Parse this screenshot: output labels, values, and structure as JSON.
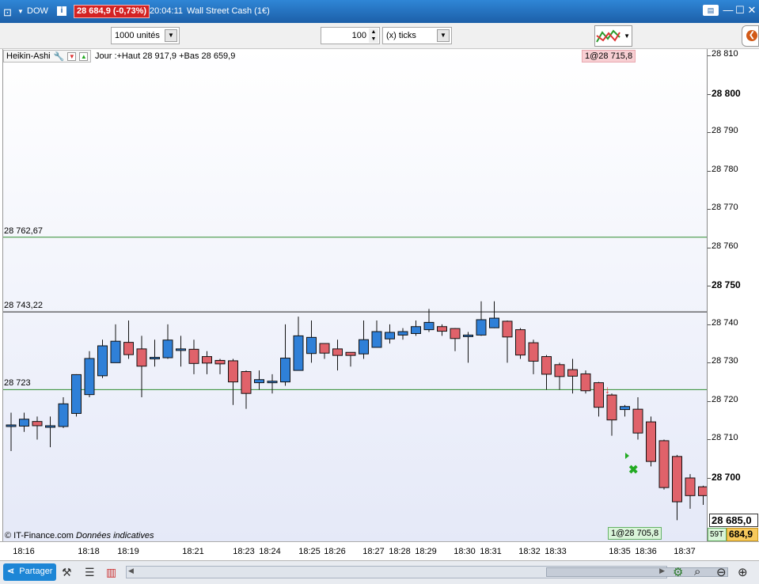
{
  "titlebar": {
    "symbol": "DOW",
    "last_price": "28 684,9 (-0,73%)",
    "time": "20:04:11",
    "instrument": "Wall Street Cash (1€)"
  },
  "toolbar": {
    "units": "1000 unités",
    "ticks_value": "100",
    "ticks_unit": "(x) ticks"
  },
  "chart_header": {
    "indicator": "Heikin-Ashi",
    "info": "Jour :+Haut 28 917,9 +Bas 28 659,9",
    "order_top": "1@28 715,8",
    "order_bottom": "1@28 705,8",
    "watermark": "© IT-Finance.com",
    "watermark_note": "Données indicatives"
  },
  "levels": [
    {
      "label": "28 762,67",
      "value": 28762.67,
      "color": "#2e8b2e"
    },
    {
      "label": "28 743,22",
      "value": 28743.22,
      "color": "#222222"
    },
    {
      "label": "28 723",
      "value": 28723,
      "color": "#2e8b2e"
    }
  ],
  "price_axis": {
    "ticks": [
      {
        "label": "28 810",
        "value": 28810,
        "bold": false
      },
      {
        "label": "28 800",
        "value": 28800,
        "bold": true
      },
      {
        "label": "28 790",
        "value": 28790,
        "bold": false
      },
      {
        "label": "28 780",
        "value": 28780,
        "bold": false
      },
      {
        "label": "28 770",
        "value": 28770,
        "bold": false
      },
      {
        "label": "28 760",
        "value": 28760,
        "bold": false
      },
      {
        "label": "28 750",
        "value": 28750,
        "bold": true
      },
      {
        "label": "28 740",
        "value": 28740,
        "bold": false
      },
      {
        "label": "28 730",
        "value": 28730,
        "bold": false
      },
      {
        "label": "28 720",
        "value": 28720,
        "bold": false
      },
      {
        "label": "28 710",
        "value": 28710,
        "bold": false
      },
      {
        "label": "28 700",
        "value": 28700,
        "bold": true
      }
    ],
    "current_price_label": "28 685,0",
    "countdown": "59T",
    "current_small": "684,9"
  },
  "time_axis": [
    "18:16",
    "18:18",
    "18:19",
    "18:21",
    "18:23",
    "18:24",
    "18:25",
    "18:26",
    "18:27",
    "18:28",
    "18:29",
    "18:30",
    "18:31",
    "18:32",
    "18:33",
    "18:35",
    "18:36",
    "18:37"
  ],
  "bottombar": {
    "share_label": "Partager"
  },
  "colors": {
    "up": "#2f80d8",
    "down": "#e0626a"
  },
  "chart_data": {
    "type": "candlestick",
    "y_range": [
      28685,
      28813
    ],
    "candles": [
      {
        "o": 28713.5,
        "c": 28713.8,
        "h": 28717,
        "l": 28707
      },
      {
        "o": 28713.5,
        "c": 28715.3,
        "h": 28717,
        "l": 28712
      },
      {
        "o": 28714.7,
        "c": 28713.6,
        "h": 28716,
        "l": 28710
      },
      {
        "o": 28713.3,
        "c": 28713.6,
        "h": 28716,
        "l": 28708
      },
      {
        "o": 28713.4,
        "c": 28719.3,
        "h": 28721,
        "l": 28713
      },
      {
        "o": 28716.8,
        "c": 28726.9,
        "h": 28727,
        "l": 28716
      },
      {
        "o": 28721.7,
        "c": 28731.1,
        "h": 28733,
        "l": 28721
      },
      {
        "o": 28726.6,
        "c": 28734.4,
        "h": 28736,
        "l": 28726
      },
      {
        "o": 28730,
        "c": 28735.6,
        "h": 28740,
        "l": 28730
      },
      {
        "o": 28735.3,
        "c": 28732.1,
        "h": 28741,
        "l": 28731
      },
      {
        "o": 28733.6,
        "c": 28729.1,
        "h": 28737,
        "l": 28721
      },
      {
        "o": 28731.1,
        "c": 28731.4,
        "h": 28736,
        "l": 28729
      },
      {
        "o": 28731.3,
        "c": 28735.9,
        "h": 28740,
        "l": 28731
      },
      {
        "o": 28733.6,
        "c": 28733.6,
        "h": 28737,
        "l": 28729
      },
      {
        "o": 28733.5,
        "c": 28729.8,
        "h": 28736,
        "l": 28727
      },
      {
        "o": 28731.6,
        "c": 28729.9,
        "h": 28733,
        "l": 28727
      },
      {
        "o": 28730.6,
        "c": 28729.7,
        "h": 28731,
        "l": 28727
      },
      {
        "o": 28730.5,
        "c": 28725,
        "h": 28731,
        "l": 28719
      },
      {
        "o": 28727.7,
        "c": 28722,
        "h": 28728,
        "l": 28718
      },
      {
        "o": 28724.8,
        "c": 28725.6,
        "h": 28728,
        "l": 28723
      },
      {
        "o": 28725.2,
        "c": 28725.2,
        "h": 28727,
        "l": 28722
      },
      {
        "o": 28725,
        "c": 28731.2,
        "h": 28740,
        "l": 28724
      },
      {
        "o": 28728,
        "c": 28737,
        "h": 28742,
        "l": 28728
      },
      {
        "o": 28732.4,
        "c": 28736.6,
        "h": 28741,
        "l": 28730
      },
      {
        "o": 28735,
        "c": 28732.5,
        "h": 28735,
        "l": 28731
      },
      {
        "o": 28733.6,
        "c": 28731.9,
        "h": 28736,
        "l": 28728
      },
      {
        "o": 28732.7,
        "c": 28731.9,
        "h": 28732,
        "l": 28729
      },
      {
        "o": 28732.3,
        "c": 28736,
        "h": 28741,
        "l": 28731
      },
      {
        "o": 28734,
        "c": 28738.1,
        "h": 28741,
        "l": 28734
      },
      {
        "o": 28736.2,
        "c": 28737.9,
        "h": 28740,
        "l": 28735
      },
      {
        "o": 28737.2,
        "c": 28738.1,
        "h": 28739,
        "l": 28736
      },
      {
        "o": 28737.6,
        "c": 28739.4,
        "h": 28741,
        "l": 28737
      },
      {
        "o": 28738.6,
        "c": 28740.5,
        "h": 28744,
        "l": 28738
      },
      {
        "o": 28739.4,
        "c": 28738.2,
        "h": 28740,
        "l": 28737
      },
      {
        "o": 28738.9,
        "c": 28736.3,
        "h": 28739,
        "l": 28733
      },
      {
        "o": 28737,
        "c": 28737.2,
        "h": 28738,
        "l": 28730
      },
      {
        "o": 28737.2,
        "c": 28741.2,
        "h": 28746,
        "l": 28737
      },
      {
        "o": 28739.1,
        "c": 28741.6,
        "h": 28746,
        "l": 28739
      },
      {
        "o": 28740.8,
        "c": 28736.7,
        "h": 28741,
        "l": 28730
      },
      {
        "o": 28738.6,
        "c": 28732,
        "h": 28739,
        "l": 28731
      },
      {
        "o": 28735.2,
        "c": 28730.4,
        "h": 28736,
        "l": 28727
      },
      {
        "o": 28731.6,
        "c": 28727,
        "h": 28732,
        "l": 28723
      },
      {
        "o": 28729.5,
        "c": 28726.4,
        "h": 28730,
        "l": 28723
      },
      {
        "o": 28728.2,
        "c": 28726.5,
        "h": 28731,
        "l": 28722
      },
      {
        "o": 28727.1,
        "c": 28722.7,
        "h": 28728,
        "l": 28722
      },
      {
        "o": 28724.8,
        "c": 28718.4,
        "h": 28725,
        "l": 28716
      },
      {
        "o": 28721.6,
        "c": 28715.1,
        "h": 28722,
        "l": 28711
      },
      {
        "o": 28717.8,
        "c": 28718.6,
        "h": 28719,
        "l": 28716
      },
      {
        "o": 28717.9,
        "c": 28711.7,
        "h": 28721,
        "l": 28710
      },
      {
        "o": 28714.6,
        "c": 28704.3,
        "h": 28716,
        "l": 28703
      },
      {
        "o": 28709.7,
        "c": 28697.5,
        "h": 28710,
        "l": 28697
      },
      {
        "o": 28705.6,
        "c": 28693.8,
        "h": 28706,
        "l": 28689
      },
      {
        "o": 28700,
        "c": 28695.4,
        "h": 28701,
        "l": 28692
      },
      {
        "o": 28697.7,
        "c": 28695.4,
        "h": 28698,
        "l": 28693
      }
    ]
  }
}
